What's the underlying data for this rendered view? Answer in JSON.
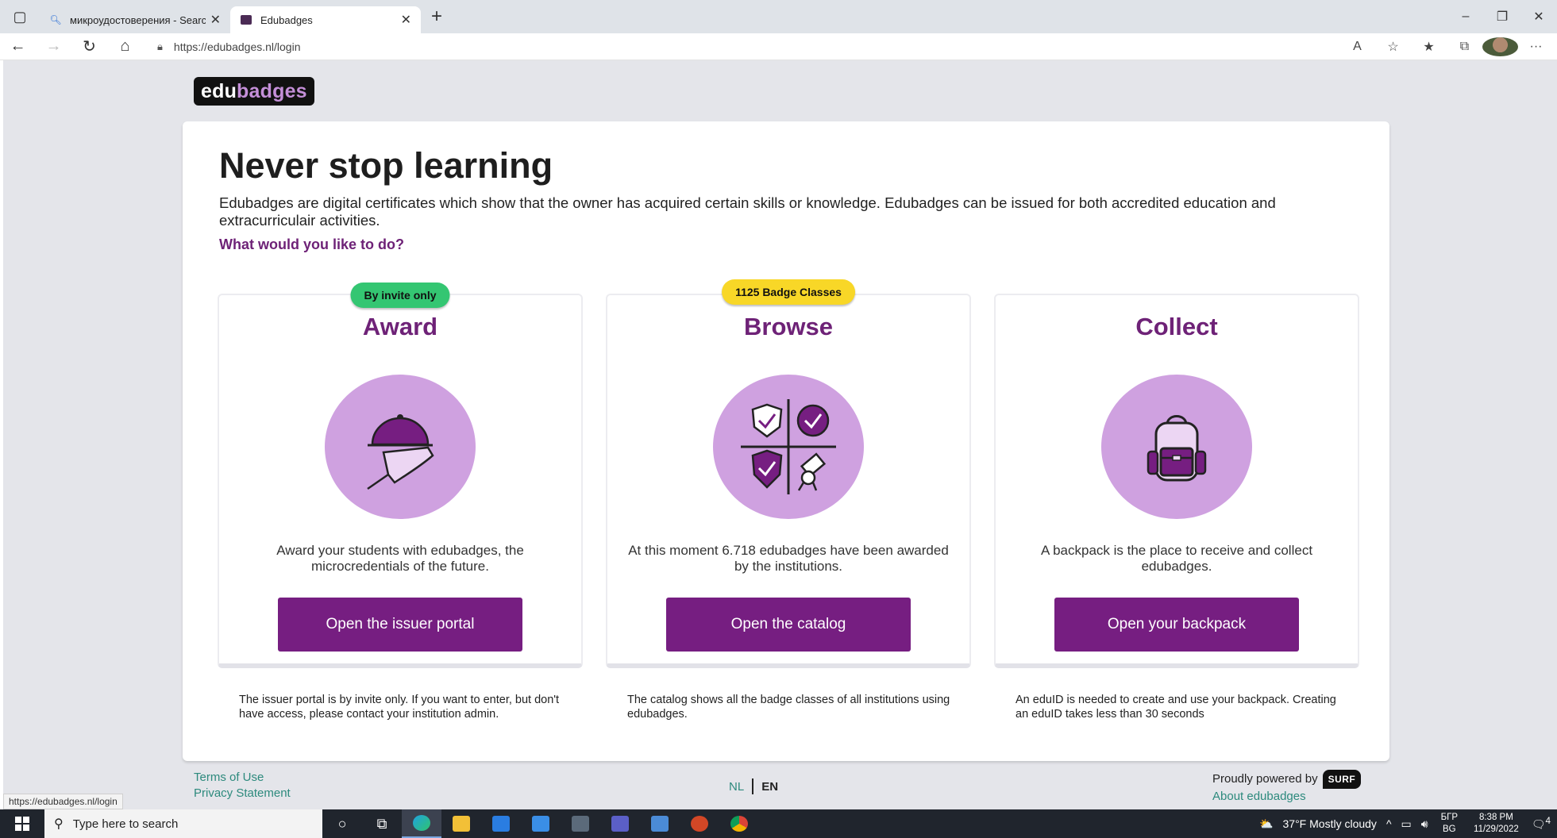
{
  "browser": {
    "tabs": [
      {
        "title": "микроудостоверения - Search",
        "active": false
      },
      {
        "title": "Edubadges",
        "active": true
      }
    ],
    "url": "https://edubadges.nl/login"
  },
  "logo": {
    "part1": "edu",
    "part2": "badges"
  },
  "hero": {
    "title": "Never stop learning",
    "description": "Edubadges are digital certificates which show that the owner has acquired certain skills or knowledge. Edubadges can be issued for both accredited education and extracurriculair activities.",
    "question": "What would you like to do?"
  },
  "columns": [
    {
      "badge": "By invite only",
      "title": "Award",
      "text": "Award your students with edubadges, the microcredentials of the future.",
      "button": "Open the issuer portal",
      "note": "The issuer portal is by invite only. If you want to enter, but don't have access, please contact your institution admin."
    },
    {
      "badge": "1125 Badge Classes",
      "title": "Browse",
      "text": "At this moment 6.718 edubadges have been awarded by the institutions.",
      "button": "Open the catalog",
      "note": "The catalog shows all the badge classes of all institutions using edubadges."
    },
    {
      "badge": "",
      "title": "Collect",
      "text": "A backpack is the place to receive and collect edubadges.",
      "button": "Open your backpack",
      "note": "An eduID is needed to create and use your backpack. Creating an eduID takes less than 30 seconds"
    }
  ],
  "footer": {
    "terms": "Terms of Use",
    "privacy": "Privacy Statement",
    "lang_nl": "NL",
    "lang_en": "EN",
    "powered": "Proudly powered by",
    "surf": "SURF",
    "about": "About edubadges"
  },
  "status_url": "https://edubadges.nl/login",
  "taskbar": {
    "search_placeholder": "Type here to search",
    "weather": "37°F  Mostly cloudy",
    "lang": "БГР",
    "lang2": "BG",
    "time": "8:38 PM",
    "date": "11/29/2022",
    "notifications": "4"
  },
  "colors": {
    "brand_purple": "#761e81",
    "accent_light": "#cfa1e0",
    "link_teal": "#2d8a7d"
  }
}
